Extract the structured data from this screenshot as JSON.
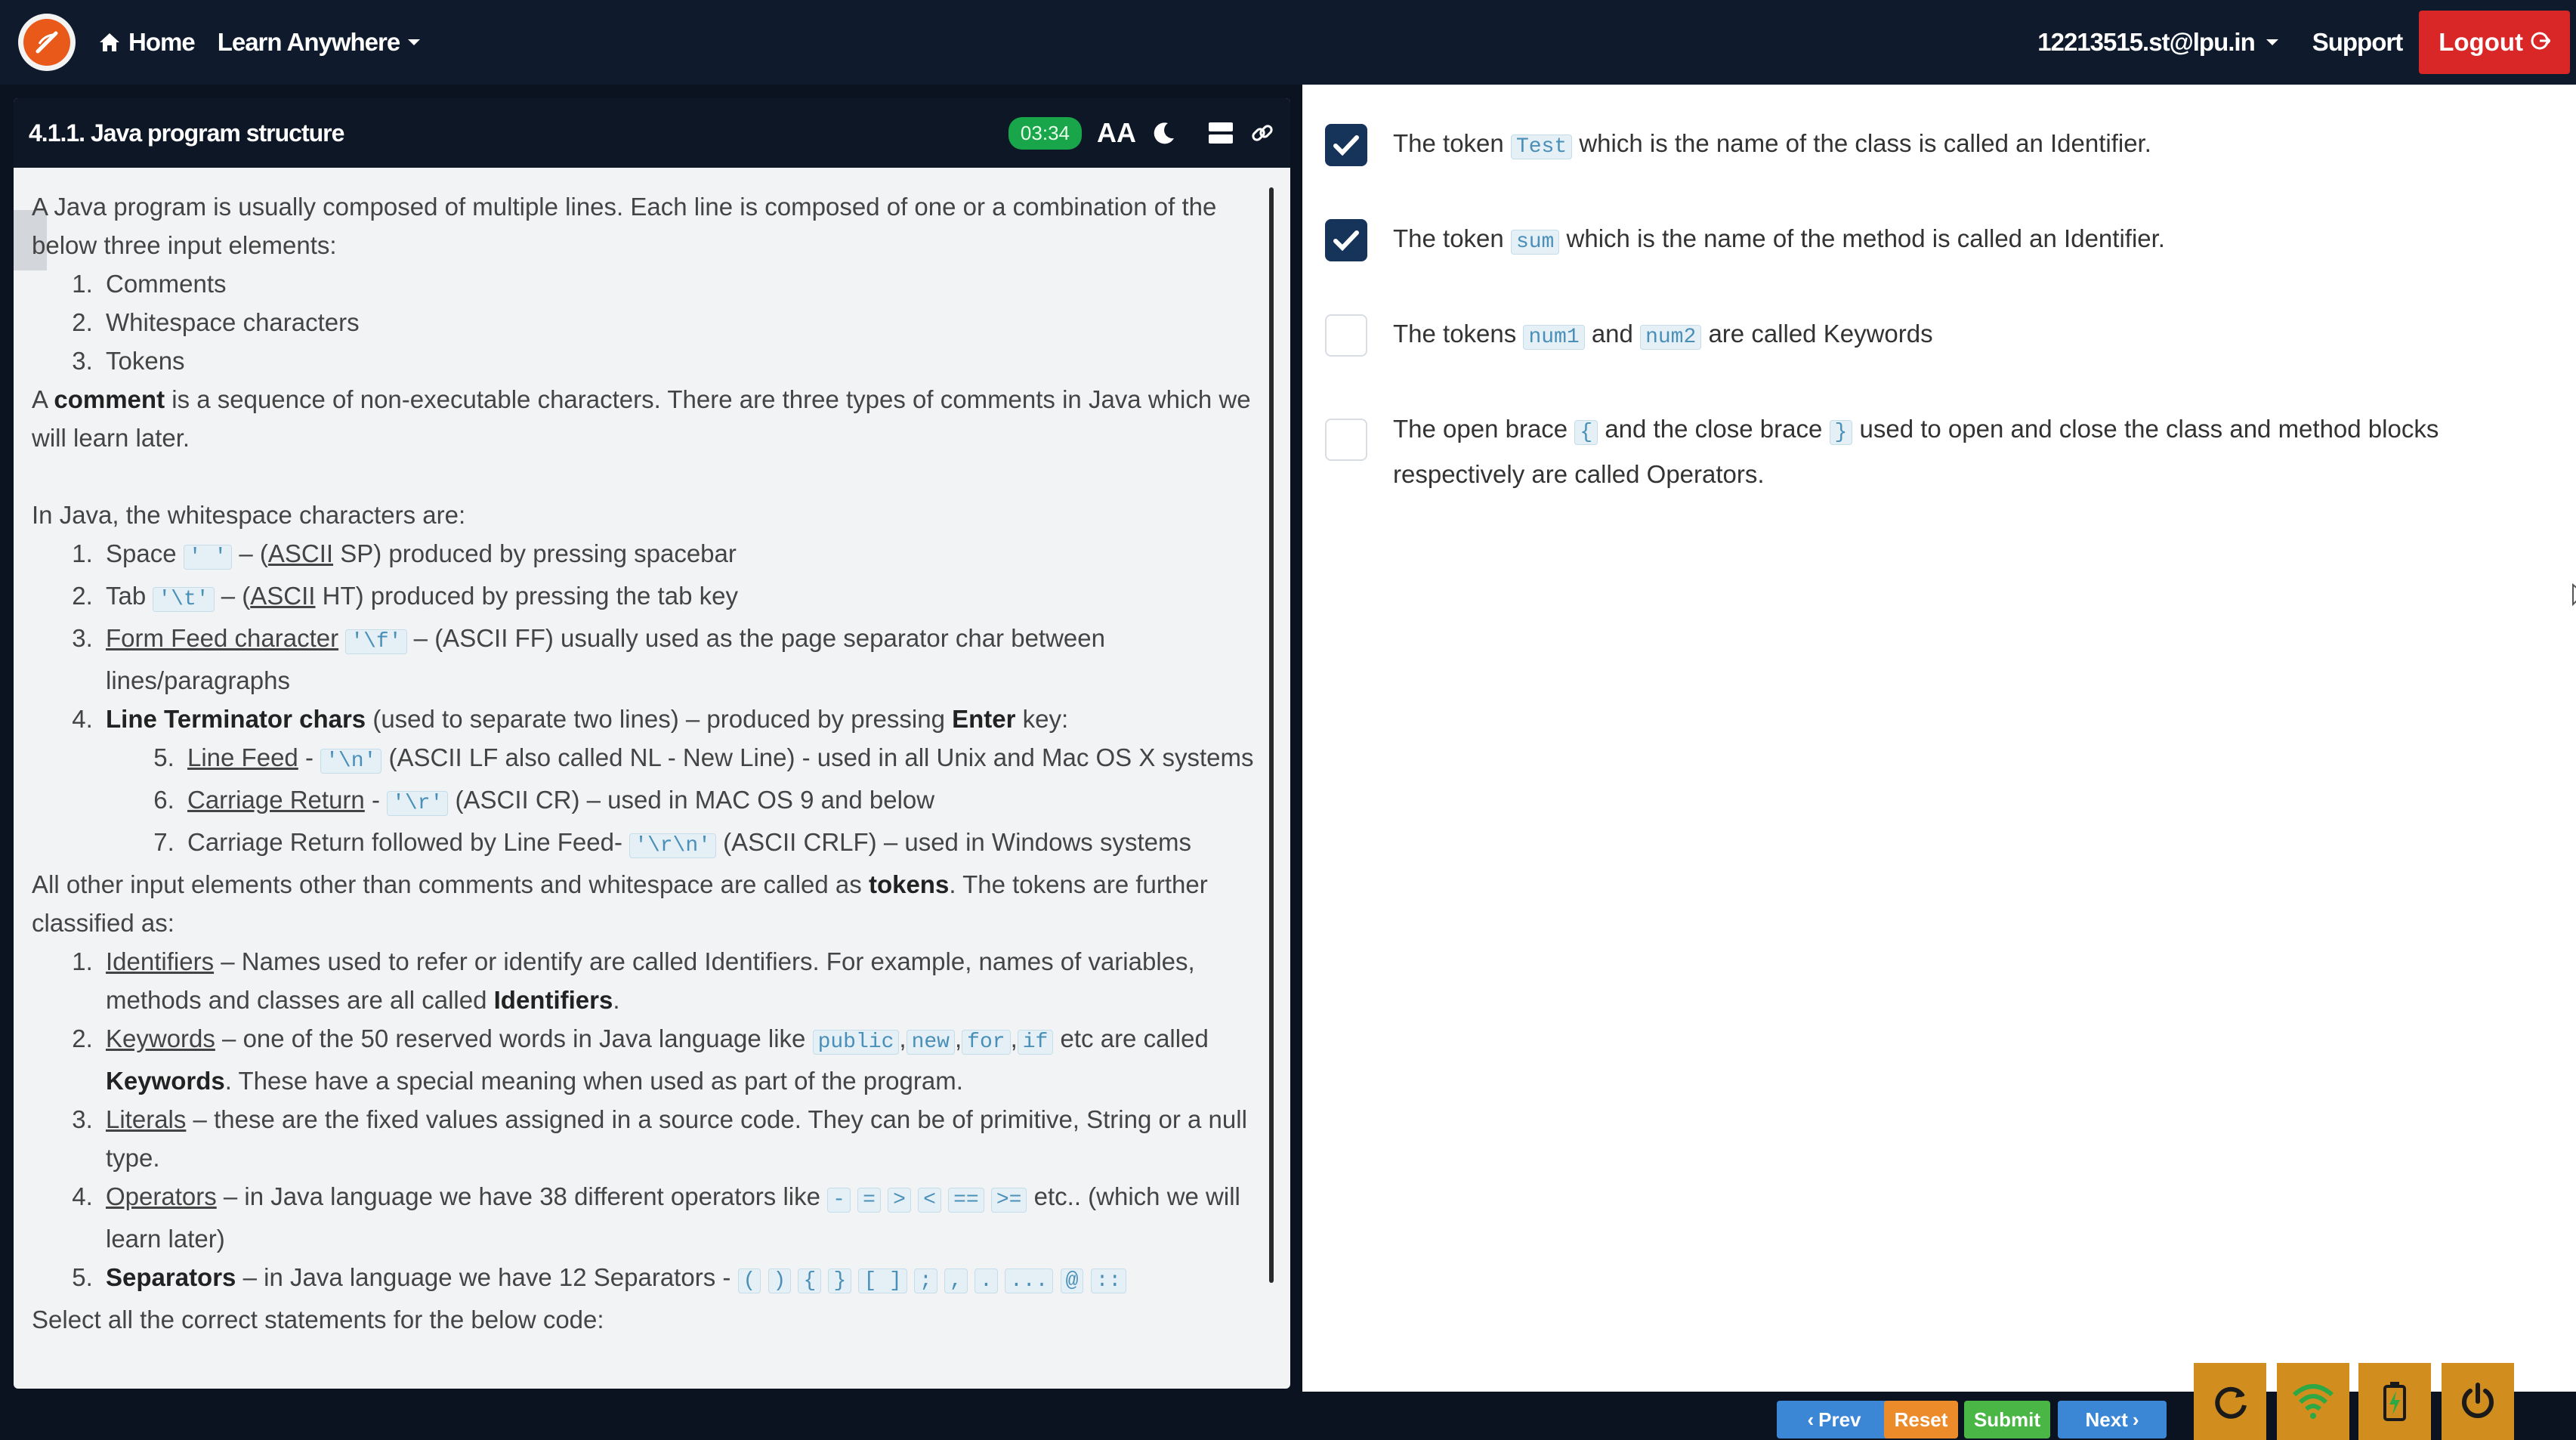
{
  "header": {
    "logo": "lpu-logo",
    "home_label": "Home",
    "learn_label": "Learn Anywhere",
    "user_email": "12213515.st@lpu.in",
    "support_label": "Support",
    "logout_label": "Logout"
  },
  "lesson": {
    "title": "4.1.1. Java program structure",
    "timer": "03:34",
    "font_icon_label": "AA"
  },
  "content": {
    "intro": "A Java program is usually composed of multiple lines. Each line is composed of one or a combination of the below three input elements:",
    "elements": [
      "Comments",
      "Whitespace characters",
      "Tokens"
    ],
    "comment_pre": "A ",
    "comment_bold": "comment",
    "comment_post": " is a sequence of non-executable characters. There are three types of comments in Java which we will learn later.",
    "ws_intro": "In Java, the whitespace characters are:",
    "ws1_pre": "Space ",
    "ws1_code": "' '",
    "ws1_mid": " – (",
    "ws1_link": "ASCII",
    "ws1_post": " SP) produced by pressing spacebar",
    "ws2_pre": "Tab ",
    "ws2_code": "'\\t'",
    "ws2_mid": " – (",
    "ws2_link": "ASCII",
    "ws2_post": " HT) produced by pressing the tab key",
    "ws3_link": "Form Feed character",
    "ws3_code": "'\\f'",
    "ws3_post": " – (ASCII FF) usually used as the page separator char between lines/paragraphs",
    "ws4_bold": "Line Terminator chars",
    "ws4_mid": " (used to separate two lines) – produced by pressing ",
    "ws4_enter": "Enter",
    "ws4_post": " key:",
    "lt5_link": "Line Feed",
    "lt5_sep": " - ",
    "lt5_code": "'\\n'",
    "lt5_post": " (ASCII LF also called NL - New Line) - used in all Unix and Mac OS X systems",
    "lt6_link": "Carriage Return",
    "lt6_sep": " - ",
    "lt6_code": "'\\r'",
    "lt6_post": " (ASCII CR) – used in MAC OS 9 and below",
    "lt7_pre": "Carriage Return followed by Line Feed- ",
    "lt7_code": "'\\r\\n'",
    "lt7_post": " (ASCII CRLF) – used in Windows systems",
    "tokens_pre": "All other input elements other than comments and whitespace are called as ",
    "tokens_bold": "tokens",
    "tokens_post": ". The tokens are further classified as:",
    "t1_link": "Identifiers",
    "t1_mid": " – Names used to refer or identify are called Identifiers. For example, names of variables, methods and classes are all called ",
    "t1_bold": "Identifiers",
    "t1_end": ".",
    "t2_link": "Keywords",
    "t2_mid": " – one of the 50 reserved words in Java language like ",
    "t2_codes": [
      "public",
      "new",
      "for",
      "if"
    ],
    "t2_comma": ",",
    "t2_post": " etc are called ",
    "t2_bold": "Keywords",
    "t2_end": ". These have a special meaning when used as part of the program.",
    "t3_link": "Literals",
    "t3_post": " – these are the fixed values assigned in a source code. They can be of primitive, String or a null type.",
    "t4_link": "Operators",
    "t4_mid": " – in Java language we have 38 different operators like ",
    "t4_codes": [
      "-",
      "=",
      ">",
      "<",
      "==",
      ">="
    ],
    "t4_post": " etc.. (which we will learn later)",
    "t5_bold": "Separators",
    "t5_mid": " – in Java language we have 12 Separators - ",
    "t5_codes": [
      "(",
      ")",
      "{",
      "}",
      "[ ]",
      ";",
      ",",
      ".",
      "...",
      "@",
      "::"
    ],
    "question": "Select all the correct statements for the below code:"
  },
  "quiz": {
    "options": [
      {
        "checked": true,
        "pre": "The token ",
        "code": "Test",
        "post": " which is the name of the class is called an Identifier."
      },
      {
        "checked": true,
        "pre": "The token ",
        "code": "sum",
        "post": " which is the name of the method is called an Identifier."
      },
      {
        "checked": false,
        "pre": "The tokens ",
        "code": "num1",
        "mid": "and ",
        "code2": "num2",
        "post": " are called Keywords"
      },
      {
        "checked": false,
        "pre": "The open brace ",
        "code": "{",
        "mid": " and the close brace ",
        "code2": "}",
        "post": " used to open and close the class and method blocks respectively are called Operators."
      }
    ]
  },
  "footer": {
    "prev_label": "Prev",
    "reset_label": "Reset",
    "submit_label": "Submit",
    "next_label": "Next",
    "dock_icons": [
      "refresh-icon",
      "wifi-icon",
      "battery-icon",
      "power-icon"
    ]
  },
  "colors": {
    "nav_bg": "#0f1b2d",
    "logout_red": "#d92626",
    "timer_green": "#19a54a",
    "checkbox_checked": "#16335a",
    "prev_next_blue": "#3b87d6",
    "reset_orange": "#ec8b2a",
    "submit_green": "#49b646",
    "dock_orange": "#d18e1e"
  }
}
